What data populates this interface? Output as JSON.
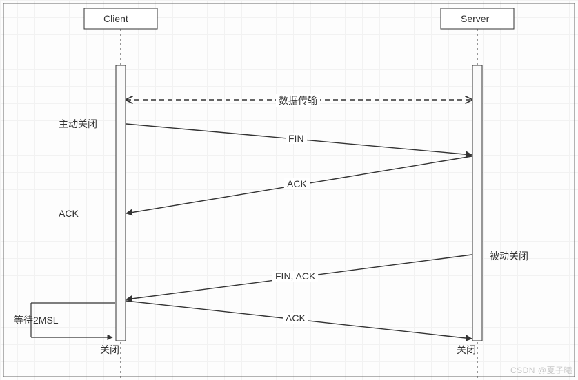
{
  "participants": {
    "client": "Client",
    "server": "Server"
  },
  "labels": {
    "data_transfer": "数据传输",
    "active_close": "主动关闭",
    "passive_close": "被动关闭",
    "wait_2msl": "等待2MSL",
    "close_client": "关闭",
    "close_server": "关闭"
  },
  "messages": {
    "m1": "FIN",
    "m2": "ACK",
    "m2b": "ACK",
    "m3": "FIN, ACK",
    "m4": "ACK"
  },
  "watermark": "CSDN @夏子曦"
}
